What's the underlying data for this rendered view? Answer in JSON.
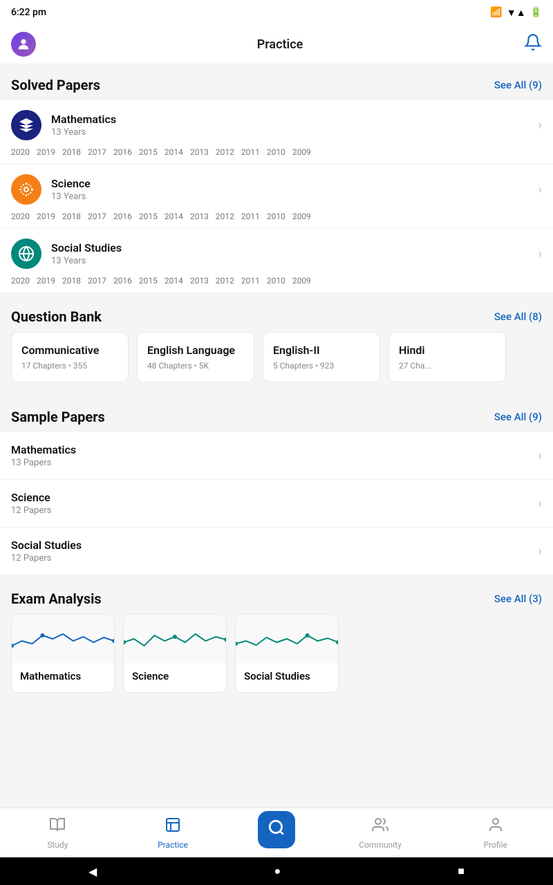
{
  "statusBar": {
    "time": "6:22 pm",
    "icons": [
      "🔇",
      "📶",
      "🔋"
    ]
  },
  "topNav": {
    "title": "Practice",
    "bellIcon": "🔔"
  },
  "solvedPapers": {
    "sectionTitle": "Solved Papers",
    "seeAll": "See All (9)",
    "items": [
      {
        "name": "Mathematics",
        "subtitle": "13 Years",
        "iconColor": "#1a237e",
        "iconEmoji": "📐",
        "years": [
          "2020",
          "2019",
          "2018",
          "2017",
          "2016",
          "2015",
          "2014",
          "2013",
          "2012",
          "2011",
          "2010",
          "2009"
        ]
      },
      {
        "name": "Science",
        "subtitle": "13 Years",
        "iconColor": "#f57f17",
        "iconEmoji": "⚛️",
        "years": [
          "2020",
          "2019",
          "2018",
          "2017",
          "2016",
          "2015",
          "2014",
          "2013",
          "2012",
          "2011",
          "2010",
          "2009"
        ]
      },
      {
        "name": "Social Studies",
        "subtitle": "13 Years",
        "iconColor": "#00897b",
        "iconEmoji": "🌐",
        "years": [
          "2020",
          "2019",
          "2018",
          "2017",
          "2016",
          "2015",
          "2014",
          "2013",
          "2012",
          "2011",
          "2010",
          "2009"
        ]
      }
    ]
  },
  "questionBank": {
    "sectionTitle": "Question Bank",
    "seeAll": "See All (8)",
    "items": [
      {
        "name": "Communicative",
        "chapters": "17 Chapters",
        "count": "355"
      },
      {
        "name": "English Language",
        "chapters": "48 Chapters",
        "count": "5K"
      },
      {
        "name": "English-II",
        "chapters": "5 Chapters",
        "count": "923"
      },
      {
        "name": "Hindi",
        "chapters": "27 Cha...",
        "count": ""
      }
    ]
  },
  "samplePapers": {
    "sectionTitle": "Sample Papers",
    "seeAll": "See All (9)",
    "items": [
      {
        "name": "Mathematics",
        "papers": "13 Papers"
      },
      {
        "name": "Science",
        "papers": "12 Papers"
      },
      {
        "name": "Social Studies",
        "papers": "12 Papers"
      }
    ]
  },
  "examAnalysis": {
    "sectionTitle": "Exam Analysis",
    "seeAll": "See All (3)",
    "items": [
      {
        "name": "Mathematics",
        "chartColor": "#1565c0"
      },
      {
        "name": "Science",
        "chartColor": "#00897b"
      },
      {
        "name": "Social Studies",
        "chartColor": "#00897b"
      }
    ]
  },
  "bottomNav": {
    "items": [
      {
        "id": "study",
        "label": "Study",
        "icon": "📚",
        "active": false
      },
      {
        "id": "practice",
        "label": "Practice",
        "icon": "📝",
        "active": true
      },
      {
        "id": "search",
        "label": "",
        "icon": "🔍",
        "active": false
      },
      {
        "id": "community",
        "label": "Community",
        "icon": "👥",
        "active": false
      },
      {
        "id": "profile",
        "label": "Profile",
        "icon": "👤",
        "active": false
      }
    ]
  },
  "androidNav": {
    "back": "◀",
    "home": "●",
    "recent": "■"
  }
}
